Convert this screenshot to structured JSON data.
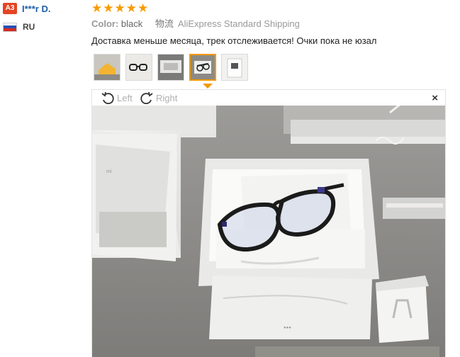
{
  "user": {
    "level": "A3",
    "name": "I***r D.",
    "country": "RU"
  },
  "review": {
    "rating": 5,
    "color_label": "Color:",
    "color_value": "black",
    "shipping_label": "物流",
    "shipping_value": "AliExpress Standard Shipping",
    "comment": "Доставка меньше месяца, трек отслеживается! Очки пока не юзал"
  },
  "thumbnails": [
    {
      "icon": "photo-cheese-thumb"
    },
    {
      "icon": "photo-glasses-thumb"
    },
    {
      "icon": "photo-box-thumb"
    },
    {
      "icon": "photo-glasses-box-thumb",
      "active": true
    },
    {
      "icon": "photo-label-thumb"
    }
  ],
  "viewer": {
    "rotate_left": "Left",
    "rotate_right": "Right",
    "close": "×"
  },
  "colors": {
    "accent": "#f39800",
    "star": "#f79b00",
    "name": "#1f5ea8",
    "badge": "#e44424"
  }
}
